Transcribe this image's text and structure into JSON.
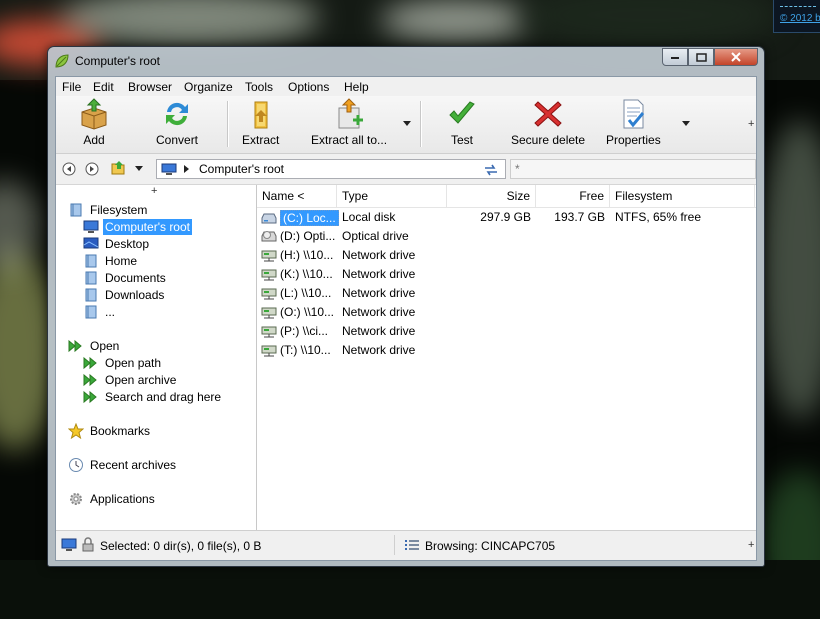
{
  "desktop": {
    "corner_link": "© 2012 b"
  },
  "window": {
    "title": "Computer's root"
  },
  "menu": [
    "File",
    "Edit",
    "Browser",
    "Organize",
    "Tools",
    "Options",
    "Help"
  ],
  "toolbar": {
    "add": "Add",
    "convert": "Convert",
    "extract": "Extract",
    "extract_all": "Extract all to...",
    "test": "Test",
    "secure_delete": "Secure delete",
    "properties": "Properties",
    "overflow": "+"
  },
  "address": {
    "path": "Computer's root",
    "search_placeholder": "*"
  },
  "tree": {
    "plus": "+",
    "filesystem": "Filesystem",
    "items": [
      "Computer's root",
      "Desktop",
      "Home",
      "Documents",
      "Downloads",
      "..."
    ],
    "open": "Open",
    "open_items": [
      "Open path",
      "Open archive",
      "Search and drag here"
    ],
    "bookmarks": "Bookmarks",
    "recent": "Recent archives",
    "applications": "Applications"
  },
  "columns": {
    "name": "Name <",
    "type": "Type",
    "size": "Size",
    "free": "Free",
    "filesystem": "Filesystem"
  },
  "rows": [
    {
      "name": "(C:) Loc...",
      "type": "Local disk",
      "size": "297.9 GB",
      "free": "193.7 GB",
      "fs": "NTFS, 65% free"
    },
    {
      "name": "(D:) Opti...",
      "type": "Optical drive",
      "size": "",
      "free": "",
      "fs": ""
    },
    {
      "name": "(H:) \\\\10...",
      "type": "Network drive",
      "size": "",
      "free": "",
      "fs": ""
    },
    {
      "name": "(K:) \\\\10...",
      "type": "Network drive",
      "size": "",
      "free": "",
      "fs": ""
    },
    {
      "name": "(L:) \\\\10...",
      "type": "Network drive",
      "size": "",
      "free": "",
      "fs": ""
    },
    {
      "name": "(O:) \\\\10...",
      "type": "Network drive",
      "size": "",
      "free": "",
      "fs": ""
    },
    {
      "name": "(P:) \\\\ci...",
      "type": "Network drive",
      "size": "",
      "free": "",
      "fs": ""
    },
    {
      "name": "(T:) \\\\10...",
      "type": "Network drive",
      "size": "",
      "free": "",
      "fs": ""
    }
  ],
  "status": {
    "selected": "Selected: 0 dir(s), 0 file(s), 0 B",
    "browsing": "Browsing: CINCAPC705",
    "plus": "+"
  }
}
